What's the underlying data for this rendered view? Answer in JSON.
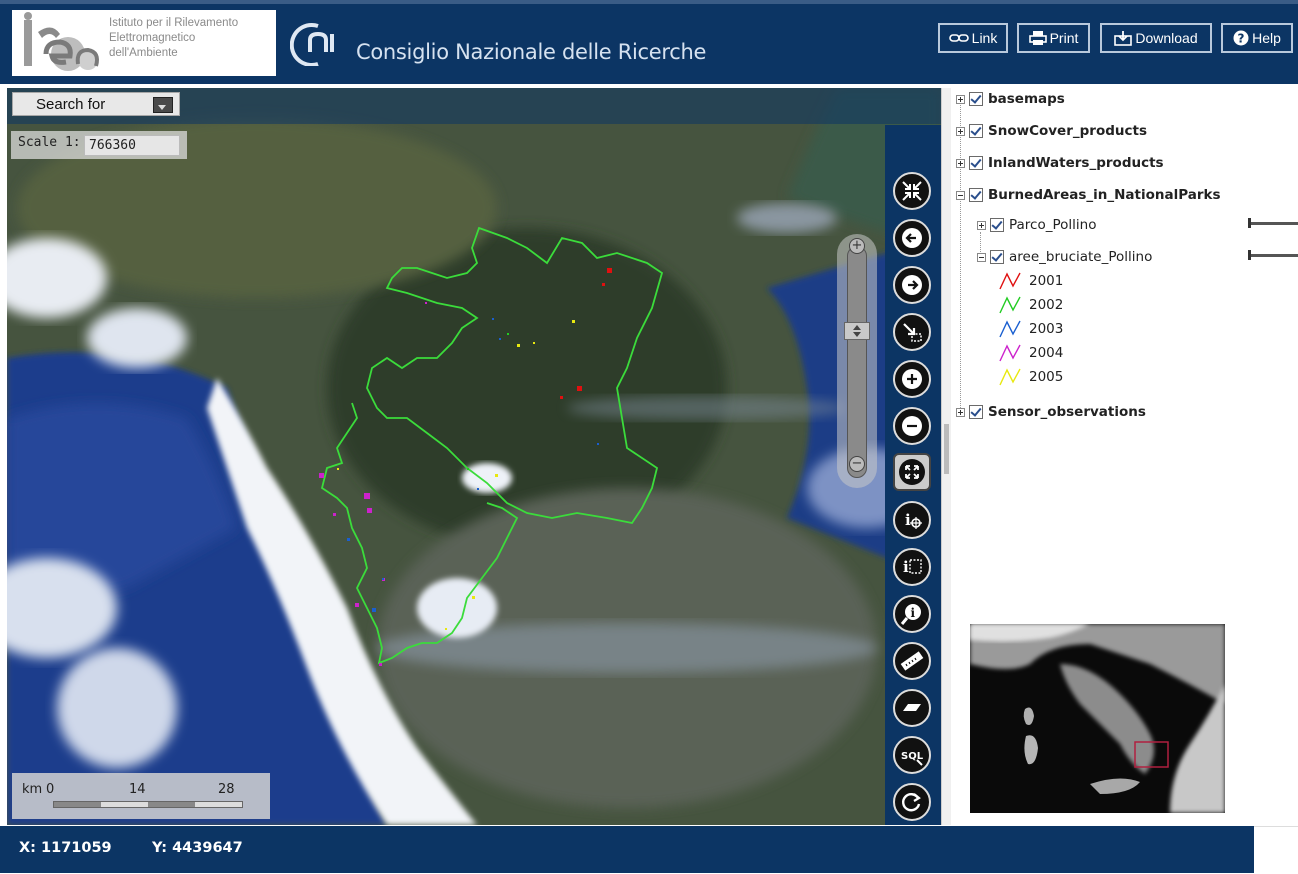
{
  "header": {
    "irea_lines": [
      "Istituto per il Rilevamento",
      "Elettromagnetico",
      "dell'Ambiente"
    ],
    "org_name": "Consiglio Nazionale delle Ricerche",
    "buttons": {
      "link": "Link",
      "print": "Print",
      "download": "Download",
      "help": "Help"
    }
  },
  "map": {
    "search_label": "Search for",
    "scale_label": "Scale 1:",
    "scale_value": "766360",
    "scalebar": {
      "unit": "km",
      "ticks": [
        "0",
        "14",
        "28"
      ]
    }
  },
  "layers": {
    "basemaps": "basemaps",
    "snow": "SnowCover_products",
    "inland": "InlandWaters_products",
    "burned": "BurnedAreas_in_NationalParks",
    "parco": "Parco_Pollino",
    "aree": "aree_bruciate_Pollino",
    "sensor": "Sensor_observations",
    "legend": [
      {
        "year": "2001",
        "color": "#e01010"
      },
      {
        "year": "2002",
        "color": "#22cc22"
      },
      {
        "year": "2003",
        "color": "#1a5fd0"
      },
      {
        "year": "2004",
        "color": "#cc22cc"
      },
      {
        "year": "2005",
        "color": "#e8e810"
      }
    ]
  },
  "status": {
    "x": "X: 1171059",
    "y": "Y: 4439647"
  }
}
